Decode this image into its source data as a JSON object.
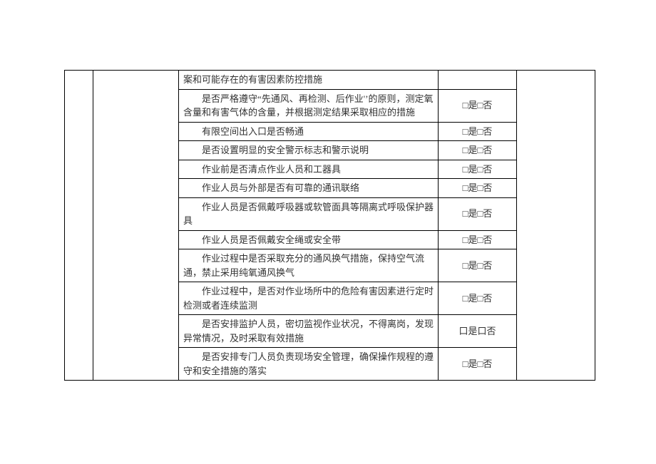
{
  "check_label": "□是□否",
  "rows": [
    {
      "text": "案和可能存在的有害因素防控措施",
      "indent": false,
      "check": ""
    },
    {
      "text": "是否严格遵守“先通风、再检测、后作业'’的原则，测定氧含量和有害气体的含量，并根据测定结果采取相应的措施",
      "indent": true,
      "check": "□是□否"
    },
    {
      "text": "有限空间出入口是否畅通",
      "indent": true,
      "check": "□是□否"
    },
    {
      "text": "是否设置明显的安全警示标志和警示说明",
      "indent": true,
      "check": "□是□否"
    },
    {
      "text": "作业前是否清点作业人员和工器具",
      "indent": true,
      "check": "□是□否"
    },
    {
      "text": "作业人员与外部是否有可靠的通讯联络",
      "indent": true,
      "check": "□是□否"
    },
    {
      "text": "作业人员是否佩戴呼吸器或软管面具等隔离式呼吸保护器具",
      "indent": true,
      "check": "□是□否"
    },
    {
      "text": "作业人员是否佩戴安全绳或安全带",
      "indent": true,
      "check": "□是□否"
    },
    {
      "text": "作业过程中是否采取充分的通风换气措施，保持空气流通，禁止采用纯氧通风换气",
      "indent": true,
      "check": "□是□否"
    },
    {
      "text": "作业过程中，是否对作业场所中的危险有害因素进行定时检测或者连续监测",
      "indent": true,
      "check": "□是□否"
    },
    {
      "text": "是否安排监护人员，密切监视作业状况，不得离岗，发现异常情况，及时采取有效措施",
      "indent": true,
      "check": "口是口否"
    },
    {
      "text": "是否安排专门人员负责现场安全管理，确保操作规程的遵守和安全措施的落实",
      "indent": true,
      "check": "□是□否"
    }
  ]
}
